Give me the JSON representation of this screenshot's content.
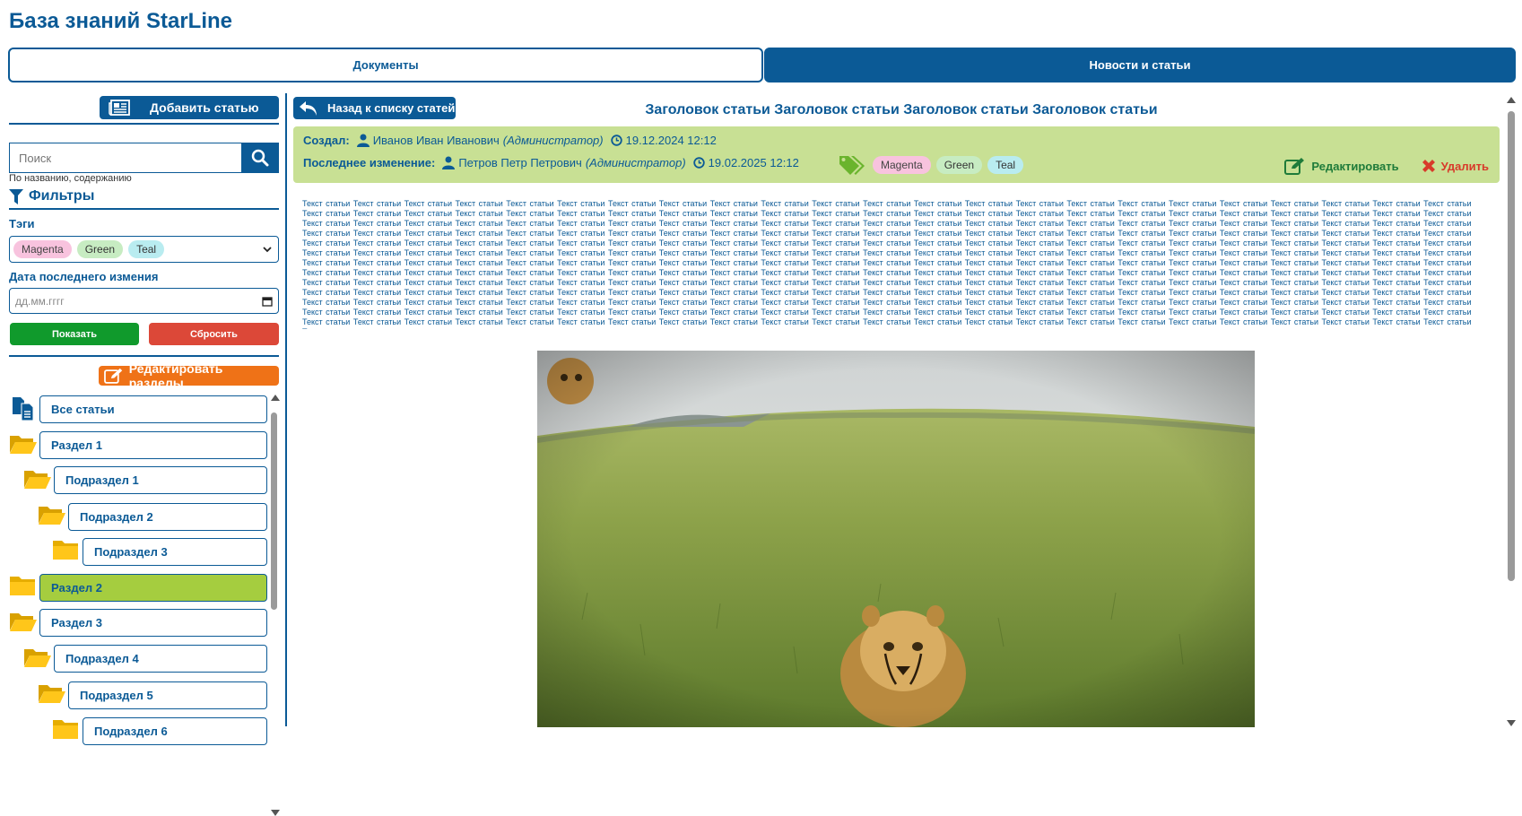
{
  "app": {
    "title": "База знаний StarLine"
  },
  "tabs": [
    {
      "label": "Документы",
      "active": false
    },
    {
      "label": "Новости и статьи",
      "active": true
    }
  ],
  "sidebar": {
    "add_article": "Добавить статью",
    "search_placeholder": "Поиск",
    "search_hint": "По названию, содержанию",
    "filters_title": "Фильтры",
    "tags_label": "Тэги",
    "tags": [
      "Magenta",
      "Green",
      "Teal"
    ],
    "date_label": "Дата последнего измения",
    "date_placeholder": "дд.мм.гггг",
    "show_button": "Показать",
    "reset_button": "Сбросить",
    "edit_sections": "Редактировать разделы",
    "tree": [
      {
        "label": "Все статьи",
        "level": 0,
        "icon": "documents-icon",
        "active": false
      },
      {
        "label": "Раздел 1",
        "level": 0,
        "icon": "folder-open-icon",
        "active": false
      },
      {
        "label": "Подраздел 1",
        "level": 1,
        "icon": "folder-open-icon",
        "active": false
      },
      {
        "label": "Подраздел 2",
        "level": 2,
        "icon": "folder-open-icon",
        "active": false
      },
      {
        "label": "Подраздел 3",
        "level": 3,
        "icon": "folder-closed-icon",
        "active": false
      },
      {
        "label": "Раздел 2",
        "level": 0,
        "icon": "folder-closed-icon",
        "active": true
      },
      {
        "label": "Раздел 3",
        "level": 0,
        "icon": "folder-open-icon",
        "active": false
      },
      {
        "label": "Подраздел 4",
        "level": 1,
        "icon": "folder-open-icon",
        "active": false
      },
      {
        "label": "Подраздел 5",
        "level": 2,
        "icon": "folder-open-icon",
        "active": false
      },
      {
        "label": "Подраздел 6",
        "level": 3,
        "icon": "folder-closed-icon",
        "active": false
      }
    ]
  },
  "article": {
    "back_button": "Назад к списку статей",
    "title": "Заголовок статьи Заголовок статьи Заголовок статьи Заголовок статьи",
    "created_label": "Создал:",
    "created_by": "Иванов Иван Иванович",
    "created_role": "(Администратор)",
    "created_at": "19.12.2024 12:12",
    "modified_label": "Последнее изменение:",
    "modified_by": "Петров Петр Петрович",
    "modified_role": "(Администратор)",
    "modified_at": "19.02.2025 12:12",
    "tags": [
      "Magenta",
      "Green",
      "Teal"
    ],
    "edit_button": "Редактировать",
    "delete_button": "Удалить",
    "body_word": "Текст статьи",
    "body_word_count": 300
  },
  "colors": {
    "brand": "#0b5a96",
    "meta_bg": "#c8e094",
    "active_item": "#a5cd3f",
    "show": "#109a2c",
    "reset": "#dc4838",
    "edit_sections": "#ef7217"
  }
}
